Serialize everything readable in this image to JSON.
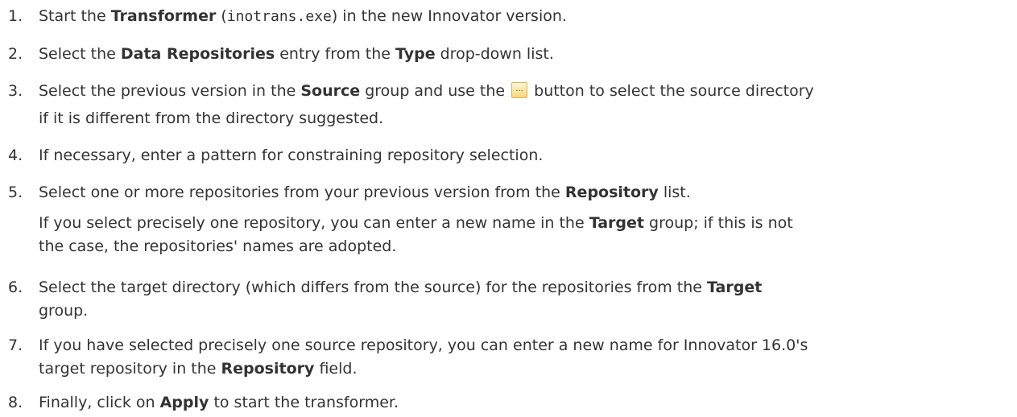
{
  "steps": [
    {
      "number": "1.",
      "s1": "Start the ",
      "b1": "Transformer",
      "s2": " (",
      "code": "inotrans.exe",
      "s3": ") in the new Innovator version."
    },
    {
      "number": "2.",
      "s1": "Select the ",
      "b1": "Data Repositories",
      "s2": " entry from the ",
      "b2": "Type",
      "s3": " drop-down list."
    },
    {
      "number": "3.",
      "s1": "Select the previous version in the ",
      "b1": "Source",
      "s2": " group and use the ",
      "button_icon": "ellipsis-browse-icon",
      "s3": " button to select the source directory",
      "line2": "if it is different from the directory suggested."
    },
    {
      "number": "4.",
      "s1": "If necessary, enter a pattern for constraining repository selection."
    },
    {
      "number": "5.",
      "s1": "Select one or more repositories from your previous version from the ",
      "b1": "Repository",
      "s2": " list.",
      "sub1": "If you select precisely one repository, you can enter a new name in the ",
      "sub_b1": "Target",
      "sub2": " group; if this is not",
      "sub_line2": "the case, the repositories' names are adopted."
    },
    {
      "number": "6.",
      "s1": "Select the target directory (which differs from the source) for the repositories from the ",
      "b1": "Target",
      "line2": "group."
    },
    {
      "number": "7.",
      "s1": "If you have selected precisely one source repository, you can enter a new name for Innovator 16.0's",
      "line2_s1": "target repository in the ",
      "line2_b1": "Repository",
      "line2_s2": " field."
    },
    {
      "number": "8.",
      "s1": "Finally, click on ",
      "b1": "Apply",
      "s2": " to start the transformer."
    }
  ]
}
